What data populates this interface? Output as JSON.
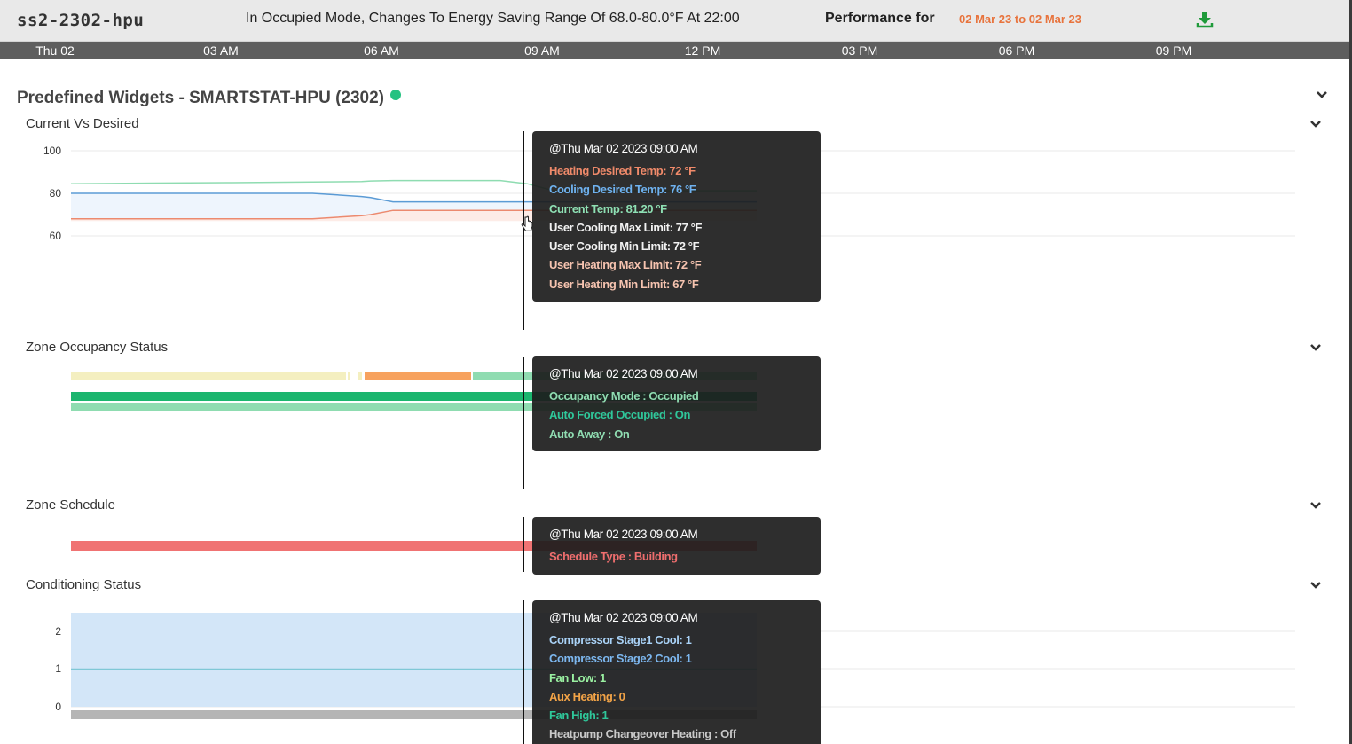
{
  "header": {
    "device_name": "ss2-2302-hpu",
    "message": "In Occupied Mode, Changes To Energy Saving Range Of 68.0-80.0°F At 22:00",
    "performance_label": "Performance for",
    "performance_range": "02 Mar 23 to 02 Mar 23",
    "download_icon": "download-icon"
  },
  "time_axis": [
    "Thu 02",
    "03 AM",
    "06 AM",
    "09 AM",
    "12 PM",
    "03 PM",
    "06 PM",
    "09 PM"
  ],
  "page_title": "Predefined Widgets - SMARTSTAT-HPU (2302)",
  "status_color": "#26c281",
  "sections": {
    "current_vs_desired": {
      "title": "Current Vs Desired",
      "y_ticks": [
        "100",
        "80",
        "60"
      ],
      "tooltip": {
        "heading": "@Thu Mar 02 2023 09:00 AM",
        "rows": [
          "Heating Desired Temp: 72 °F",
          "Cooling Desired Temp: 76 °F",
          "Current Temp: 81.20 °F",
          "User Cooling Max Limit: 77 °F",
          "User Cooling Min Limit: 72 °F",
          "User Heating Max Limit: 72 °F",
          "User Heating Min Limit: 67 °F"
        ]
      }
    },
    "zone_occupancy": {
      "title": "Zone Occupancy Status",
      "tooltip": {
        "heading": "@Thu Mar 02 2023 09:00 AM",
        "rows": [
          "Occupancy Mode : Occupied",
          "Auto Forced Occupied : On",
          "Auto Away : On"
        ]
      }
    },
    "zone_schedule": {
      "title": "Zone Schedule",
      "tooltip": {
        "heading": "@Thu Mar 02 2023 09:00 AM",
        "rows": [
          "Schedule Type : Building"
        ]
      }
    },
    "conditioning_status": {
      "title": "Conditioning Status",
      "y_ticks": [
        "2",
        "1",
        "0"
      ],
      "tooltip": {
        "heading": "@Thu Mar 02 2023 09:00 AM",
        "rows": [
          "Compressor Stage1 Cool: 1",
          "Compressor Stage2 Cool: 1",
          "Fan Low: 1",
          "Aux Heating: 0",
          "Fan High: 1",
          "Heatpump Changeover Heating : Off"
        ]
      }
    }
  },
  "chart_data": [
    {
      "type": "line",
      "title": "Current Vs Desired",
      "ylim": [
        60,
        100
      ],
      "x": [
        "00:00",
        "01:30",
        "03:00",
        "04:30",
        "05:25",
        "05:35",
        "06:00",
        "07:30",
        "08:00",
        "08:30",
        "09:00",
        "10:00",
        "11:00"
      ],
      "series": [
        {
          "name": "Current Temp",
          "values": [
            84.5,
            84.8,
            85,
            85.3,
            85.5,
            85.8,
            86,
            86,
            86,
            84.5,
            81.2,
            81.2,
            81.2
          ]
        },
        {
          "name": "Cooling Desired Temp",
          "values": [
            80,
            80,
            80,
            80,
            78.5,
            78,
            76,
            76,
            76,
            76,
            76,
            76,
            76
          ]
        },
        {
          "name": "Heating Desired Temp",
          "values": [
            68,
            68,
            68,
            68,
            69.5,
            70,
            72,
            72,
            72,
            72,
            72,
            72,
            72
          ]
        },
        {
          "name": "User Cooling Max Limit",
          "values": [
            77,
            77,
            77,
            77,
            77,
            77,
            77,
            77,
            77,
            77,
            77,
            77,
            77
          ]
        },
        {
          "name": "User Heating Min Limit",
          "values": [
            67,
            67,
            67,
            67,
            67,
            67,
            67,
            67,
            67,
            67,
            67,
            67,
            67
          ]
        }
      ]
    },
    {
      "type": "line",
      "title": "Conditioning Status",
      "ylim": [
        0,
        2.5
      ],
      "x": [
        "00:00",
        "11:00"
      ],
      "series": [
        {
          "name": "Compressor Stage1 Cool",
          "values": [
            1,
            1
          ]
        }
      ]
    }
  ]
}
